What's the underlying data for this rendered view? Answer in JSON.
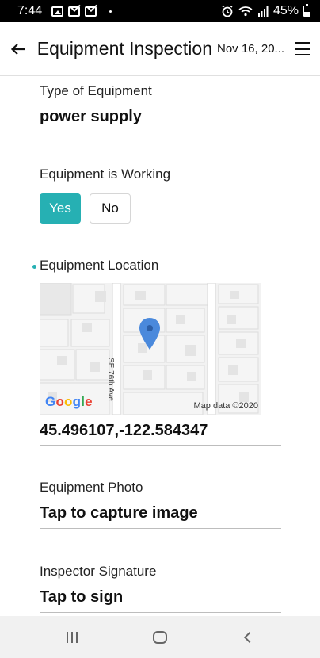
{
  "status_bar": {
    "time": "7:44",
    "battery": "45%",
    "icons": [
      "image-icon",
      "mail-icon",
      "mail-icon",
      "alarm-icon",
      "wifi-icon",
      "signal-icon",
      "battery-icon"
    ]
  },
  "app_bar": {
    "title": "Equipment Inspection",
    "date": "Nov 16, 20..."
  },
  "form": {
    "type_label": "Type of Equipment",
    "type_value": "power supply",
    "working_label": "Equipment is Working",
    "working_options": [
      "Yes",
      "No"
    ],
    "working_selected": "Yes",
    "location_label": "Equipment Location",
    "map_street": "SE 76th Ave",
    "map_attribution": "Map data ©2020",
    "map_logo": "Google",
    "location_value": "45.496107,-122.584347",
    "photo_label": "Equipment Photo",
    "photo_value": "Tap to capture image",
    "signature_label": "Inspector Signature",
    "signature_value": "Tap to sign"
  },
  "colors": {
    "accent": "#26b0b3",
    "map_pin": "#4a89dc"
  },
  "nav_bar": {
    "icons": [
      "recents-icon",
      "home-icon",
      "back-icon"
    ]
  }
}
